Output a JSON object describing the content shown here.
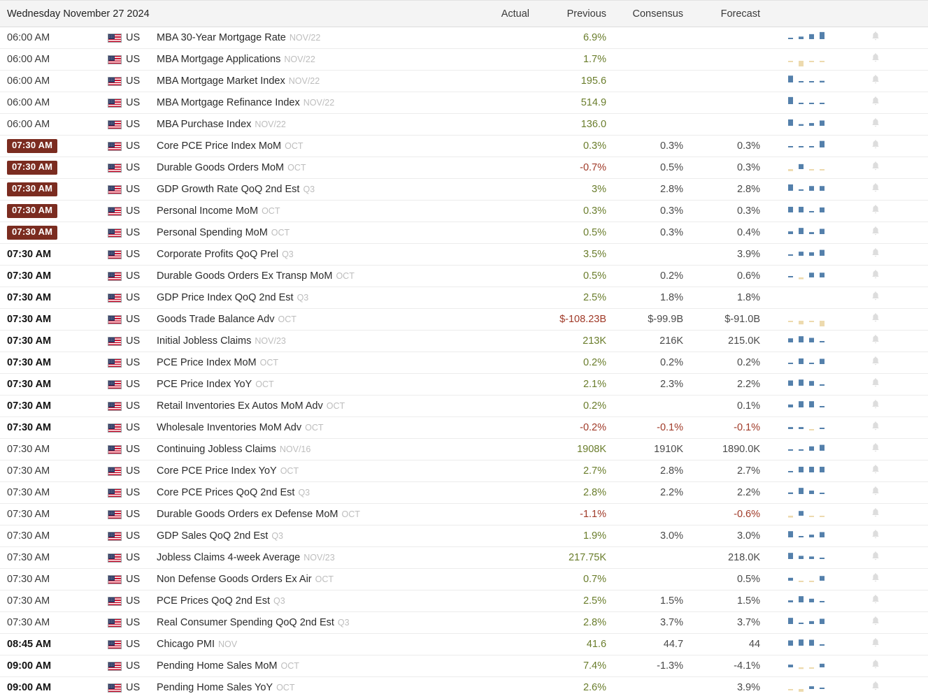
{
  "header": {
    "date_label": "Wednesday November 27 2024",
    "columns": [
      "Actual",
      "Previous",
      "Consensus",
      "Forecast"
    ]
  },
  "colors": {
    "badge_bg": "#7b2c20",
    "positive": "#6a7d2c",
    "negative": "#a03a28",
    "neutral": "#4a4a4a",
    "spark_blue": "#5480ab",
    "spark_tan": "#eddaae",
    "header_bg": "#f4f4f4"
  },
  "icons": {
    "flag": "us-flag-icon",
    "bell": "bell-icon",
    "spark": "sparkline-bar-chart-icon"
  },
  "rows": [
    {
      "time": "06:00 AM",
      "highlight": false,
      "bold": false,
      "country": "US",
      "event": "MBA 30-Year Mortgage Rate",
      "ref": "NOV/22",
      "actual": "",
      "previous": "6.9%",
      "consensus": "",
      "forecast": "",
      "prev_sign": "pos",
      "cons_sign": "neu",
      "fcst_sign": "neu",
      "spark": [
        12,
        28,
        55,
        78
      ],
      "spark_neg": [
        false,
        false,
        false,
        false
      ]
    },
    {
      "time": "06:00 AM",
      "highlight": false,
      "bold": false,
      "country": "US",
      "event": "MBA Mortgage Applications",
      "ref": "NOV/22",
      "actual": "",
      "previous": "1.7%",
      "consensus": "",
      "forecast": "",
      "prev_sign": "pos",
      "cons_sign": "neu",
      "fcst_sign": "neu",
      "spark": [
        10,
        62,
        14,
        12
      ],
      "spark_neg": [
        true,
        true,
        true,
        true
      ]
    },
    {
      "time": "06:00 AM",
      "highlight": false,
      "bold": false,
      "country": "US",
      "event": "MBA Mortgage Market Index",
      "ref": "NOV/22",
      "actual": "",
      "previous": "195.6",
      "consensus": "",
      "forecast": "",
      "prev_sign": "pos",
      "cons_sign": "neu",
      "fcst_sign": "neu",
      "spark": [
        75,
        8,
        8,
        18
      ],
      "spark_neg": [
        false,
        false,
        false,
        false
      ]
    },
    {
      "time": "06:00 AM",
      "highlight": false,
      "bold": false,
      "country": "US",
      "event": "MBA Mortgage Refinance Index",
      "ref": "NOV/22",
      "actual": "",
      "previous": "514.9",
      "consensus": "",
      "forecast": "",
      "prev_sign": "pos",
      "cons_sign": "neu",
      "fcst_sign": "neu",
      "spark": [
        78,
        7,
        7,
        7
      ],
      "spark_neg": [
        false,
        false,
        false,
        false
      ]
    },
    {
      "time": "06:00 AM",
      "highlight": false,
      "bold": false,
      "country": "US",
      "event": "MBA Purchase Index",
      "ref": "NOV/22",
      "actual": "",
      "previous": "136.0",
      "consensus": "",
      "forecast": "",
      "prev_sign": "pos",
      "cons_sign": "neu",
      "fcst_sign": "neu",
      "spark": [
        70,
        18,
        30,
        58
      ],
      "spark_neg": [
        false,
        false,
        false,
        false
      ]
    },
    {
      "time": "07:30 AM",
      "highlight": true,
      "bold": true,
      "country": "US",
      "event": "Core PCE Price Index MoM",
      "ref": "OCT",
      "actual": "",
      "previous": "0.3%",
      "consensus": "0.3%",
      "forecast": "0.3%",
      "prev_sign": "pos",
      "cons_sign": "neu",
      "fcst_sign": "neu",
      "spark": [
        9,
        9,
        9,
        72
      ],
      "spark_neg": [
        false,
        false,
        false,
        false
      ]
    },
    {
      "time": "07:30 AM",
      "highlight": true,
      "bold": true,
      "country": "US",
      "event": "Durable Goods Orders MoM",
      "ref": "OCT",
      "actual": "",
      "previous": "-0.7%",
      "consensus": "0.5%",
      "forecast": "0.3%",
      "prev_sign": "neg",
      "cons_sign": "neu",
      "fcst_sign": "neu",
      "spark": [
        22,
        55,
        10,
        10
      ],
      "spark_neg": [
        true,
        false,
        true,
        true
      ]
    },
    {
      "time": "07:30 AM",
      "highlight": true,
      "bold": true,
      "country": "US",
      "event": "GDP Growth Rate QoQ 2nd Est",
      "ref": "Q3",
      "actual": "",
      "previous": "3%",
      "consensus": "2.8%",
      "forecast": "2.8%",
      "prev_sign": "pos",
      "cons_sign": "neu",
      "fcst_sign": "neu",
      "spark": [
        70,
        10,
        52,
        52
      ],
      "spark_neg": [
        false,
        false,
        false,
        false
      ]
    },
    {
      "time": "07:30 AM",
      "highlight": true,
      "bold": true,
      "country": "US",
      "event": "Personal Income MoM",
      "ref": "OCT",
      "actual": "",
      "previous": "0.3%",
      "consensus": "0.3%",
      "forecast": "0.3%",
      "prev_sign": "pos",
      "cons_sign": "neu",
      "fcst_sign": "neu",
      "spark": [
        62,
        62,
        10,
        55
      ],
      "spark_neg": [
        false,
        false,
        false,
        false
      ]
    },
    {
      "time": "07:30 AM",
      "highlight": true,
      "bold": true,
      "country": "US",
      "event": "Personal Spending MoM",
      "ref": "OCT",
      "actual": "",
      "previous": "0.5%",
      "consensus": "0.3%",
      "forecast": "0.4%",
      "prev_sign": "pos",
      "cons_sign": "neu",
      "fcst_sign": "neu",
      "spark": [
        30,
        68,
        22,
        58
      ],
      "spark_neg": [
        false,
        false,
        false,
        false
      ]
    },
    {
      "time": "07:30 AM",
      "highlight": false,
      "bold": true,
      "country": "US",
      "event": "Corporate Profits QoQ Prel",
      "ref": "Q3",
      "actual": "",
      "previous": "3.5%",
      "consensus": "",
      "forecast": "3.9%",
      "prev_sign": "pos",
      "cons_sign": "neu",
      "fcst_sign": "neu",
      "spark": [
        8,
        45,
        38,
        65
      ],
      "spark_neg": [
        false,
        false,
        false,
        false
      ]
    },
    {
      "time": "07:30 AM",
      "highlight": false,
      "bold": true,
      "country": "US",
      "event": "Durable Goods Orders Ex Transp MoM",
      "ref": "OCT",
      "actual": "",
      "previous": "0.5%",
      "consensus": "0.2%",
      "forecast": "0.6%",
      "prev_sign": "pos",
      "cons_sign": "neu",
      "fcst_sign": "neu",
      "spark": [
        8,
        20,
        52,
        52
      ],
      "spark_neg": [
        false,
        true,
        false,
        false
      ]
    },
    {
      "time": "07:30 AM",
      "highlight": false,
      "bold": true,
      "country": "US",
      "event": "GDP Price Index QoQ 2nd Est",
      "ref": "Q3",
      "actual": "",
      "previous": "2.5%",
      "consensus": "1.8%",
      "forecast": "1.8%",
      "prev_sign": "pos",
      "cons_sign": "neu",
      "fcst_sign": "neu",
      "spark": [],
      "spark_neg": []
    },
    {
      "time": "07:30 AM",
      "highlight": false,
      "bold": true,
      "country": "US",
      "event": "Goods Trade Balance Adv",
      "ref": "OCT",
      "actual": "",
      "previous": "$-108.23B",
      "consensus": "$-99.9B",
      "forecast": "$-91.0B",
      "prev_sign": "neg",
      "cons_sign": "neu",
      "fcst_sign": "neu",
      "spark": [
        12,
        40,
        12,
        62
      ],
      "spark_neg": [
        true,
        true,
        true,
        true
      ]
    },
    {
      "time": "07:30 AM",
      "highlight": false,
      "bold": true,
      "country": "US",
      "event": "Initial Jobless Claims",
      "ref": "NOV/23",
      "actual": "",
      "previous": "213K",
      "consensus": "216K",
      "forecast": "215.0K",
      "prev_sign": "pos",
      "cons_sign": "neu",
      "fcst_sign": "neu",
      "spark": [
        45,
        68,
        50,
        10
      ],
      "spark_neg": [
        false,
        false,
        false,
        false
      ]
    },
    {
      "time": "07:30 AM",
      "highlight": false,
      "bold": true,
      "country": "US",
      "event": "PCE Price Index MoM",
      "ref": "OCT",
      "actual": "",
      "previous": "0.2%",
      "consensus": "0.2%",
      "forecast": "0.2%",
      "prev_sign": "pos",
      "cons_sign": "neu",
      "fcst_sign": "neu",
      "spark": [
        10,
        62,
        10,
        58
      ],
      "spark_neg": [
        false,
        false,
        false,
        false
      ]
    },
    {
      "time": "07:30 AM",
      "highlight": false,
      "bold": true,
      "country": "US",
      "event": "PCE Price Index YoY",
      "ref": "OCT",
      "actual": "",
      "previous": "2.1%",
      "consensus": "2.3%",
      "forecast": "2.2%",
      "prev_sign": "pos",
      "cons_sign": "neu",
      "fcst_sign": "neu",
      "spark": [
        58,
        68,
        52,
        12
      ],
      "spark_neg": [
        false,
        false,
        false,
        false
      ]
    },
    {
      "time": "07:30 AM",
      "highlight": false,
      "bold": true,
      "country": "US",
      "event": "Retail Inventories Ex Autos MoM Adv",
      "ref": "OCT",
      "actual": "",
      "previous": "0.2%",
      "consensus": "",
      "forecast": "0.1%",
      "prev_sign": "pos",
      "cons_sign": "neu",
      "fcst_sign": "neu",
      "spark": [
        32,
        68,
        68,
        12
      ],
      "spark_neg": [
        false,
        false,
        false,
        false
      ]
    },
    {
      "time": "07:30 AM",
      "highlight": false,
      "bold": true,
      "country": "US",
      "event": "Wholesale Inventories MoM Adv",
      "ref": "OCT",
      "actual": "",
      "previous": "-0.2%",
      "consensus": "-0.1%",
      "forecast": "-0.1%",
      "prev_sign": "neg",
      "cons_sign": "neg",
      "fcst_sign": "neg",
      "spark": [
        22,
        22,
        12,
        0
      ],
      "spark_neg": [
        false,
        false,
        true,
        false
      ]
    },
    {
      "time": "07:30 AM",
      "highlight": false,
      "bold": false,
      "country": "US",
      "event": "Continuing Jobless Claims",
      "ref": "NOV/16",
      "actual": "",
      "previous": "1908K",
      "consensus": "1910K",
      "forecast": "1890.0K",
      "prev_sign": "pos",
      "cons_sign": "neu",
      "fcst_sign": "neu",
      "spark": [
        10,
        10,
        48,
        65
      ],
      "spark_neg": [
        false,
        false,
        false,
        false
      ]
    },
    {
      "time": "07:30 AM",
      "highlight": false,
      "bold": false,
      "country": "US",
      "event": "Core PCE Price Index YoY",
      "ref": "OCT",
      "actual": "",
      "previous": "2.7%",
      "consensus": "2.8%",
      "forecast": "2.7%",
      "prev_sign": "pos",
      "cons_sign": "neu",
      "fcst_sign": "neu",
      "spark": [
        10,
        62,
        62,
        62
      ],
      "spark_neg": [
        false,
        false,
        false,
        false
      ]
    },
    {
      "time": "07:30 AM",
      "highlight": false,
      "bold": false,
      "country": "US",
      "event": "Core PCE Prices QoQ 2nd Est",
      "ref": "Q3",
      "actual": "",
      "previous": "2.8%",
      "consensus": "2.2%",
      "forecast": "2.2%",
      "prev_sign": "pos",
      "cons_sign": "neu",
      "fcst_sign": "neu",
      "spark": [
        18,
        68,
        38,
        14
      ],
      "spark_neg": [
        false,
        false,
        false,
        false
      ]
    },
    {
      "time": "07:30 AM",
      "highlight": false,
      "bold": false,
      "country": "US",
      "event": "Durable Goods Orders ex Defense MoM",
      "ref": "OCT",
      "actual": "",
      "previous": "-1.1%",
      "consensus": "",
      "forecast": "-0.6%",
      "prev_sign": "neg",
      "cons_sign": "neu",
      "fcst_sign": "neg",
      "spark": [
        20,
        52,
        10,
        10
      ],
      "spark_neg": [
        true,
        false,
        true,
        true
      ]
    },
    {
      "time": "07:30 AM",
      "highlight": false,
      "bold": false,
      "country": "US",
      "event": "GDP Sales QoQ 2nd Est",
      "ref": "Q3",
      "actual": "",
      "previous": "1.9%",
      "consensus": "3.0%",
      "forecast": "3.0%",
      "prev_sign": "pos",
      "cons_sign": "neu",
      "fcst_sign": "neu",
      "spark": [
        68,
        12,
        30,
        58
      ],
      "spark_neg": [
        false,
        false,
        false,
        false
      ]
    },
    {
      "time": "07:30 AM",
      "highlight": false,
      "bold": false,
      "country": "US",
      "event": "Jobless Claims 4-week Average",
      "ref": "NOV/23",
      "actual": "",
      "previous": "217.75K",
      "consensus": "",
      "forecast": "218.0K",
      "prev_sign": "pos",
      "cons_sign": "neu",
      "fcst_sign": "neu",
      "spark": [
        68,
        35,
        28,
        12
      ],
      "spark_neg": [
        false,
        false,
        false,
        false
      ]
    },
    {
      "time": "07:30 AM",
      "highlight": false,
      "bold": false,
      "country": "US",
      "event": "Non Defense Goods Orders Ex Air",
      "ref": "OCT",
      "actual": "",
      "previous": "0.7%",
      "consensus": "",
      "forecast": "0.5%",
      "prev_sign": "pos",
      "cons_sign": "neu",
      "fcst_sign": "neu",
      "spark": [
        32,
        14,
        12,
        52
      ],
      "spark_neg": [
        false,
        true,
        true,
        false
      ]
    },
    {
      "time": "07:30 AM",
      "highlight": false,
      "bold": false,
      "country": "US",
      "event": "PCE Prices QoQ 2nd Est",
      "ref": "Q3",
      "actual": "",
      "previous": "2.5%",
      "consensus": "1.5%",
      "forecast": "1.5%",
      "prev_sign": "pos",
      "cons_sign": "neu",
      "fcst_sign": "neu",
      "spark": [
        22,
        68,
        40,
        14
      ],
      "spark_neg": [
        false,
        false,
        false,
        false
      ]
    },
    {
      "time": "07:30 AM",
      "highlight": false,
      "bold": false,
      "country": "US",
      "event": "Real Consumer Spending QoQ 2nd Est",
      "ref": "Q3",
      "actual": "",
      "previous": "2.8%",
      "consensus": "3.7%",
      "forecast": "3.7%",
      "prev_sign": "pos",
      "cons_sign": "neu",
      "fcst_sign": "neu",
      "spark": [
        68,
        12,
        32,
        58
      ],
      "spark_neg": [
        false,
        false,
        false,
        false
      ]
    },
    {
      "time": "08:45 AM",
      "highlight": false,
      "bold": true,
      "country": "US",
      "event": "Chicago PMI",
      "ref": "NOV",
      "actual": "",
      "previous": "41.6",
      "consensus": "44.7",
      "forecast": "44",
      "prev_sign": "pos",
      "cons_sign": "neu",
      "fcst_sign": "neu",
      "spark": [
        58,
        68,
        65,
        14
      ],
      "spark_neg": [
        false,
        false,
        false,
        false
      ]
    },
    {
      "time": "09:00 AM",
      "highlight": false,
      "bold": true,
      "country": "US",
      "event": "Pending Home Sales MoM",
      "ref": "OCT",
      "actual": "",
      "previous": "7.4%",
      "consensus": "-1.3%",
      "forecast": "-4.1%",
      "prev_sign": "pos",
      "cons_sign": "neu",
      "fcst_sign": "neu",
      "spark": [
        30,
        18,
        10,
        40
      ],
      "spark_neg": [
        false,
        true,
        true,
        false
      ]
    },
    {
      "time": "09:00 AM",
      "highlight": false,
      "bold": true,
      "country": "US",
      "event": "Pending Home Sales YoY",
      "ref": "OCT",
      "actual": "",
      "previous": "2.6%",
      "consensus": "",
      "forecast": "3.9%",
      "prev_sign": "pos",
      "cons_sign": "neu",
      "fcst_sign": "neu",
      "spark": [
        12,
        30,
        30,
        12
      ],
      "spark_neg": [
        true,
        true,
        false,
        false
      ]
    }
  ]
}
